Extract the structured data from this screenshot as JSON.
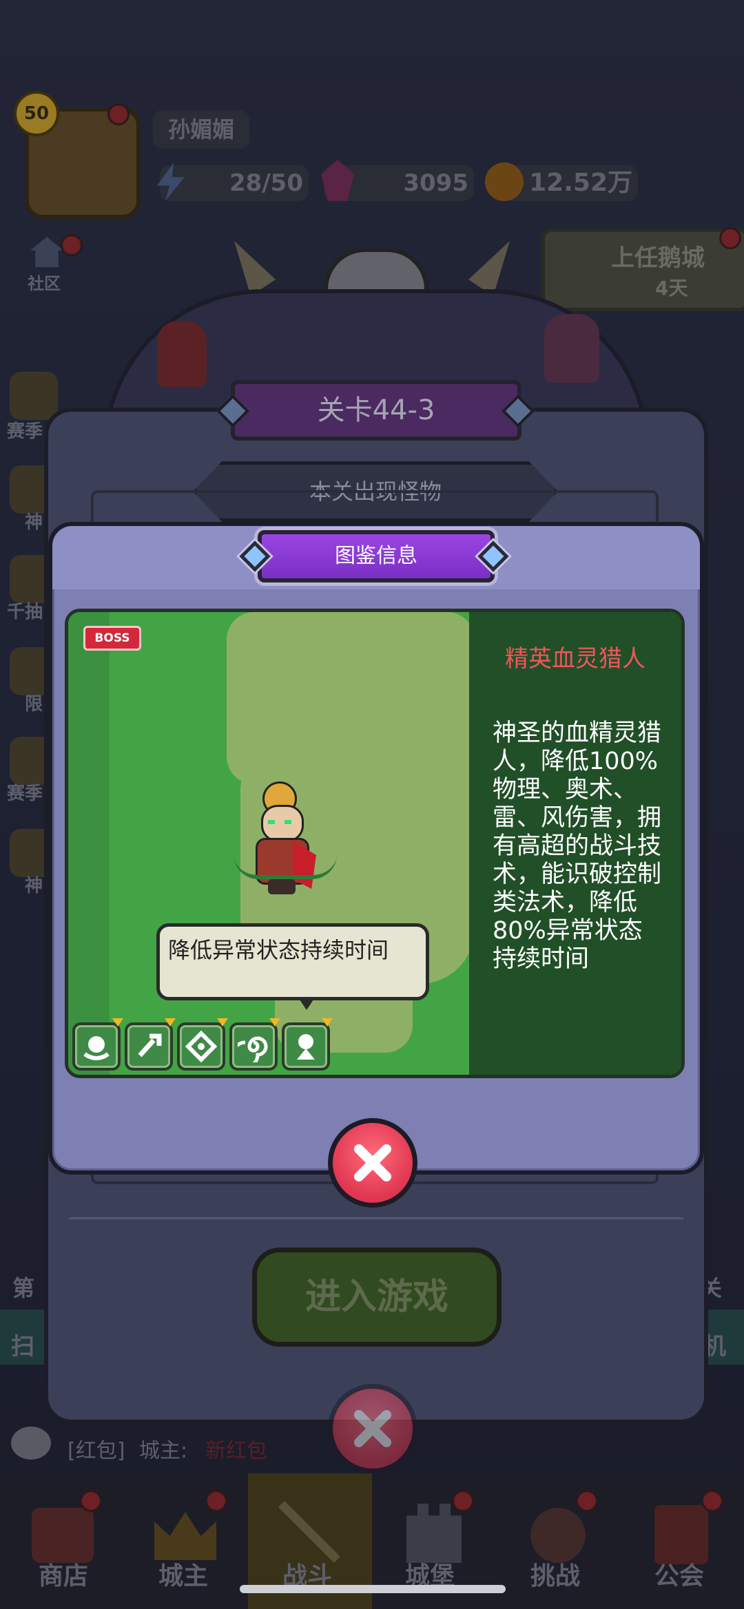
{
  "player": {
    "level": "50",
    "name": "孙媚媚",
    "energy": "28/50",
    "gems": "3095",
    "gold": "12.52万"
  },
  "side_left": {
    "community": "社区",
    "season": "赛季",
    "item1": "神",
    "item2": "千抽",
    "item3": "限",
    "item4": "赛季",
    "item5": "神"
  },
  "city": {
    "title": "上任鹅城",
    "days": "4天"
  },
  "level_panel": {
    "title": "关卡44-3",
    "monster_tab": "本关出现怪物",
    "enter_label": "进入游戏"
  },
  "codex": {
    "title": "图鉴信息",
    "boss_badge": "BOSS",
    "monster_name": "精英血灵猎人",
    "description": "神圣的血精灵猎人，降低100%物理、奥术、雷、风伤害，拥有高超的战斗技术，能识破控制类法术，降低80%异常状态持续时间",
    "tooltip": "降低异常状态持续时间",
    "skills": [
      "physical-resist-icon",
      "tech-resist-icon",
      "thunder-resist-icon",
      "wind-resist-icon",
      "status-resist-icon"
    ]
  },
  "background_text": {
    "left_chapter": "第",
    "right_chapter": "关",
    "sweep": "扫",
    "machine": "机"
  },
  "chat": {
    "prefix": "[红包]",
    "speaker": "城主:",
    "message": "新红包"
  },
  "bottom_nav": [
    "商店",
    "城主",
    "战斗",
    "城堡",
    "挑战",
    "公会"
  ]
}
